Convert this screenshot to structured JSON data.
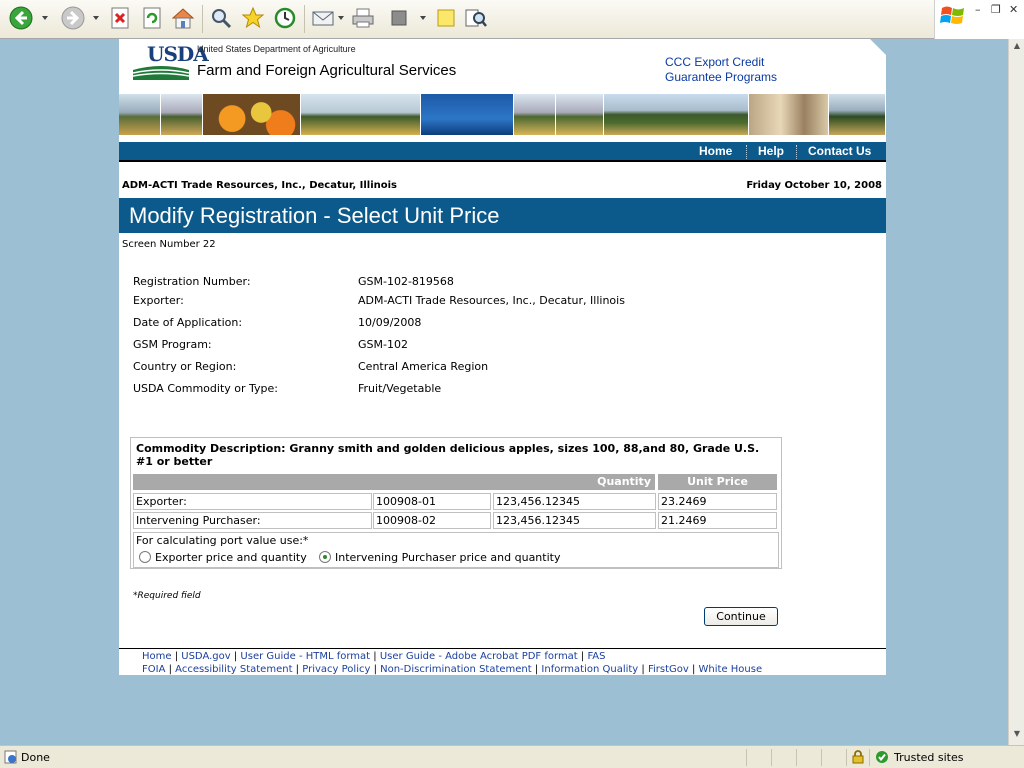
{
  "browser": {
    "status_text": "Done",
    "zone_label": "Trusted sites"
  },
  "header": {
    "logo_text": "USDA",
    "department": "United States Department of Agriculture",
    "agency": "Farm and Foreign Agricultural Services",
    "program_link_line1": "CCC Export Credit",
    "program_link_line2": "Guarantee Programs"
  },
  "nav": {
    "home": "Home",
    "help": "Help",
    "contact": "Contact Us"
  },
  "context": {
    "entity": "ADM-ACTI Trade Resources, Inc., Decatur, Illinois",
    "date": "Friday October 10, 2008"
  },
  "page": {
    "title": "Modify Registration - Select Unit Price",
    "screen_number": "Screen Number 22"
  },
  "registration": [
    {
      "label": "Registration Number:",
      "value": "GSM-102-819568"
    },
    {
      "label": "Exporter:",
      "value": "ADM-ACTI Trade Resources, Inc., Decatur, Illinois"
    },
    {
      "label": "Date of Application:",
      "value": "10/09/2008"
    },
    {
      "label": "GSM Program:",
      "value": "GSM-102"
    },
    {
      "label": "Country or Region:",
      "value": "Central America Region"
    },
    {
      "label": "USDA Commodity or Type:",
      "value": "Fruit/Vegetable"
    }
  ],
  "commodity": {
    "description": "Commodity Description: Granny smith and golden delicious apples, sizes 100, 88,and 80, Grade U.S. #1 or better",
    "col_quantity": "Quantity",
    "col_unit_price": "Unit Price",
    "rows": [
      {
        "label": "Exporter:",
        "ref": "100908-01",
        "quantity": "123,456.12345",
        "unit_price": "23.2469"
      },
      {
        "label": "Intervening Purchaser:",
        "ref": "100908-02",
        "quantity": "123,456.12345",
        "unit_price": "21.2469"
      }
    ],
    "calc_label": "For calculating port value use:*",
    "option_exporter": "Exporter price and quantity",
    "option_intervening": "Intervening Purchaser price and quantity",
    "selected_option": "intervening"
  },
  "form": {
    "required_note": "*Required field",
    "continue_label": "Continue"
  },
  "footer": {
    "row1": [
      "Home",
      "USDA.gov",
      "User Guide - HTML format",
      "User Guide - Adobe Acrobat PDF format",
      "FAS"
    ],
    "row2": [
      "FOIA",
      "Accessibility Statement",
      "Privacy Policy",
      "Non-Discrimination Statement",
      "Information Quality",
      "FirstGov",
      "White House"
    ]
  }
}
